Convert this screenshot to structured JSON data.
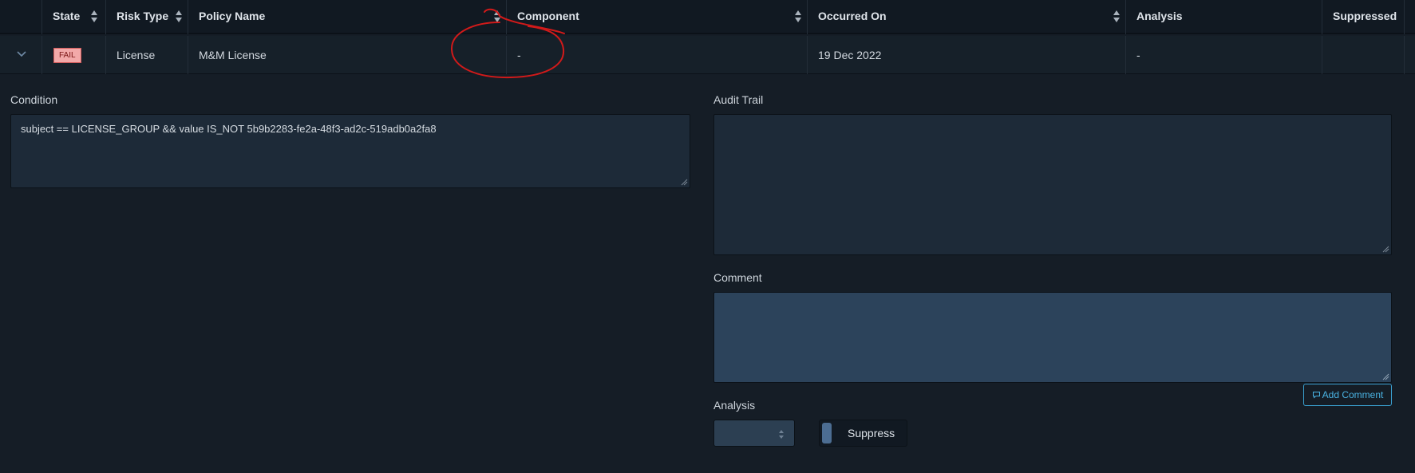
{
  "table": {
    "headers": {
      "state": "State",
      "risk_type": "Risk Type",
      "policy_name": "Policy Name",
      "component": "Component",
      "occurred_on": "Occurred On",
      "analysis": "Analysis",
      "suppressed": "Suppressed"
    },
    "row": {
      "state": "FAIL",
      "risk_type": "License",
      "policy_name": "M&M License",
      "component": "-",
      "occurred_on": "19 Dec 2022",
      "analysis": "-",
      "suppressed": ""
    }
  },
  "details": {
    "condition_label": "Condition",
    "condition_value": "subject == LICENSE_GROUP && value IS_NOT 5b9b2283-fe2a-48f3-ad2c-519adb0a2fa8",
    "audit_trail_label": "Audit Trail",
    "comment_label": "Comment",
    "add_comment_label": "Add Comment",
    "analysis_label": "Analysis",
    "suppress_label": "Suppress"
  },
  "icons": {
    "expand": "chevron-down-icon",
    "sort": "sort-icon",
    "comment": "comment-icon",
    "select_arrows": "select-arrows-icon"
  },
  "colors": {
    "background": "#151d26",
    "fail_badge_bg": "#f2a9a9",
    "fail_badge_text": "#7a1414",
    "accent": "#4ab3e3",
    "annotation_stroke": "#d11a1a"
  }
}
